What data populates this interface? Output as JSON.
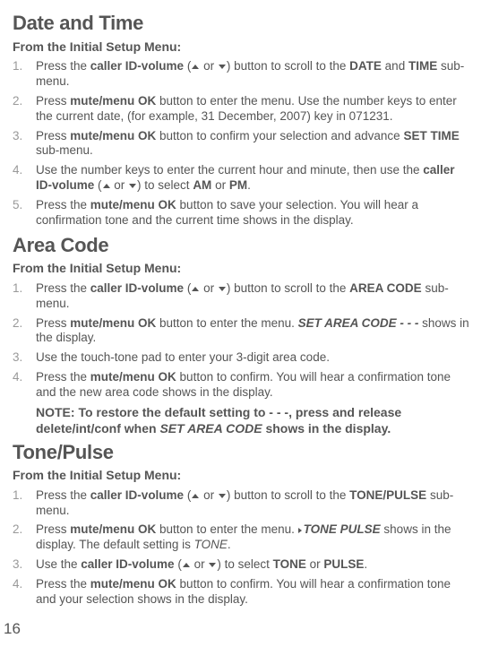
{
  "page_number": "16",
  "sections": [
    {
      "title": "Date and Time",
      "subtitle": "From the Initial Setup Menu:",
      "items": [
        {
          "num": "1.",
          "parts": [
            "Press the ",
            {
              "b": "caller ID-volume"
            },
            " (",
            {
              "up": true
            },
            " or ",
            {
              "down": true
            },
            ") button to scroll to the ",
            {
              "b": "DATE"
            },
            " and ",
            {
              "b": "TIME"
            },
            " sub-menu."
          ]
        },
        {
          "num": "2.",
          "parts": [
            "Press ",
            {
              "b": "mute/menu OK"
            },
            " button to enter the menu. Use the number keys to enter the current date, (for example, 31 December, 2007) key in 071231."
          ]
        },
        {
          "num": "3.",
          "parts": [
            "Press ",
            {
              "b": "mute/menu OK"
            },
            " button to confirm your selection and advance ",
            {
              "b": "SET TIME"
            },
            " sub-menu."
          ]
        },
        {
          "num": "4.",
          "parts": [
            "Use the number keys to enter the current hour and minute, then use the ",
            {
              "b": "caller ID-volume"
            },
            " (",
            {
              "up": true
            },
            " or ",
            {
              "down": true
            },
            ") to select ",
            {
              "b": "AM"
            },
            " or ",
            {
              "b": "PM"
            },
            "."
          ]
        },
        {
          "num": "5.",
          "parts": [
            "Press the ",
            {
              "b": "mute/menu OK"
            },
            " button to save your selection. You will hear a confirmation tone and the current time shows in the display."
          ]
        }
      ]
    },
    {
      "title": "Area Code",
      "subtitle": "From the Initial Setup Menu:",
      "items": [
        {
          "num": "1.",
          "parts": [
            "Press the ",
            {
              "b": "caller ID-volume"
            },
            " (",
            {
              "up": true
            },
            " or ",
            {
              "down": true
            },
            ") button to scroll to the ",
            {
              "b": "AREA CODE"
            },
            " sub-menu."
          ]
        },
        {
          "num": "2.",
          "parts": [
            "Press ",
            {
              "b": "mute/menu OK"
            },
            " button to enter the menu. ",
            {
              "bi": "SET AREA CODE - - -"
            },
            " shows in the display."
          ]
        },
        {
          "num": "3.",
          "parts": [
            "Use the touch-tone pad to enter your 3-digit area code."
          ]
        },
        {
          "num": "4.",
          "parts": [
            "Press the ",
            {
              "b": "mute/menu OK"
            },
            " button to confirm. You will hear a confirmation tone and the new area code shows in the display."
          ]
        }
      ],
      "note": [
        "NOTE: To restore the default setting to - - -, press and release delete/int/conf when ",
        {
          "i": "SET AREA CODE"
        },
        " shows in the display."
      ]
    },
    {
      "title": "Tone/Pulse",
      "subtitle": "From the Initial Setup Menu:",
      "items": [
        {
          "num": "1.",
          "parts": [
            "Press the ",
            {
              "b": "caller ID-volume"
            },
            " (",
            {
              "up": true
            },
            " or ",
            {
              "down": true
            },
            ") button to scroll to the ",
            {
              "b": "TONE/PULSE"
            },
            " sub-menu."
          ]
        },
        {
          "num": "2.",
          "parts": [
            "Press ",
            {
              "b": "mute/menu OK"
            },
            " button to enter the menu. ",
            {
              "right": true
            },
            {
              "bi": "TONE PULSE"
            },
            " shows in the display. The default setting is ",
            {
              "i": "TONE"
            },
            "."
          ]
        },
        {
          "num": "3.",
          "parts": [
            "Use the ",
            {
              "b": "caller ID-volume"
            },
            " (",
            {
              "up": true
            },
            " or ",
            {
              "down": true
            },
            ") to select ",
            {
              "b": "TONE"
            },
            " or ",
            {
              "b": "PULSE"
            },
            "."
          ]
        },
        {
          "num": "4.",
          "parts": [
            "Press the ",
            {
              "b": "mute/menu OK"
            },
            " button to confirm. You will hear a confirmation tone and your selection shows in the display."
          ]
        }
      ]
    }
  ]
}
